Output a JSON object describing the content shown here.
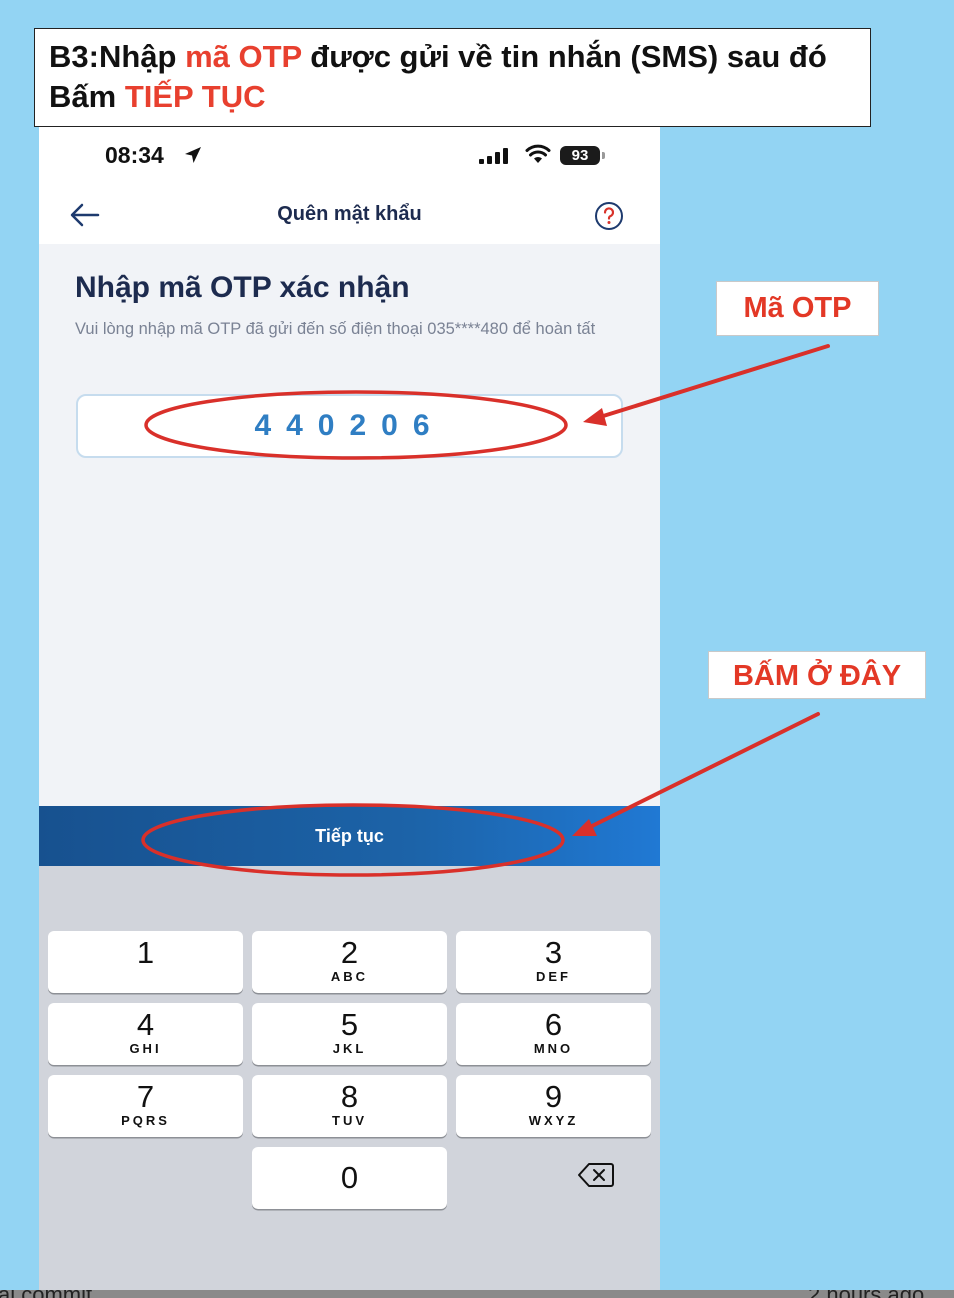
{
  "banner": {
    "line1_a": "B3:Nhập ",
    "line1_red": "mã OTP",
    "line1_b": " được gửi về tin nhắn (SMS) sau đó",
    "line2_a": "Bấm ",
    "line2_red": "TIẾP TỤC"
  },
  "status_bar": {
    "time": "08:34",
    "battery": "93"
  },
  "nav": {
    "title": "Quên mật khẩu"
  },
  "form": {
    "heading": "Nhập mã OTP xác nhận",
    "subtext": "Vui lòng nhập mã OTP đã gửi đến số điện thoại 035****480 để hoàn tất",
    "otp_value": "440206"
  },
  "continue_label": "Tiếp tục",
  "keypad": [
    {
      "num": "1",
      "letters": ""
    },
    {
      "num": "2",
      "letters": "ABC"
    },
    {
      "num": "3",
      "letters": "DEF"
    },
    {
      "num": "4",
      "letters": "GHI"
    },
    {
      "num": "5",
      "letters": "JKL"
    },
    {
      "num": "6",
      "letters": "MNO"
    },
    {
      "num": "7",
      "letters": "PQRS"
    },
    {
      "num": "8",
      "letters": "TUV"
    },
    {
      "num": "9",
      "letters": "WXYZ"
    },
    {
      "num": "0",
      "letters": ""
    }
  ],
  "annotations": {
    "otp_label": "Mã OTP",
    "tap_label": "BẤM Ở ĐÂY"
  },
  "footer": {
    "left": "al commit",
    "right": "2 hours ago"
  },
  "colors": {
    "page_background": "#93d4f3",
    "annotation_red": "#e33826",
    "otp_text": "#2f7ec3",
    "button_blue": "#1c63a8"
  },
  "icons": [
    "location-arrow-icon",
    "cellular-signal-icon",
    "wifi-icon",
    "battery-icon",
    "back-arrow-icon",
    "help-icon",
    "delete-backspace-icon"
  ]
}
